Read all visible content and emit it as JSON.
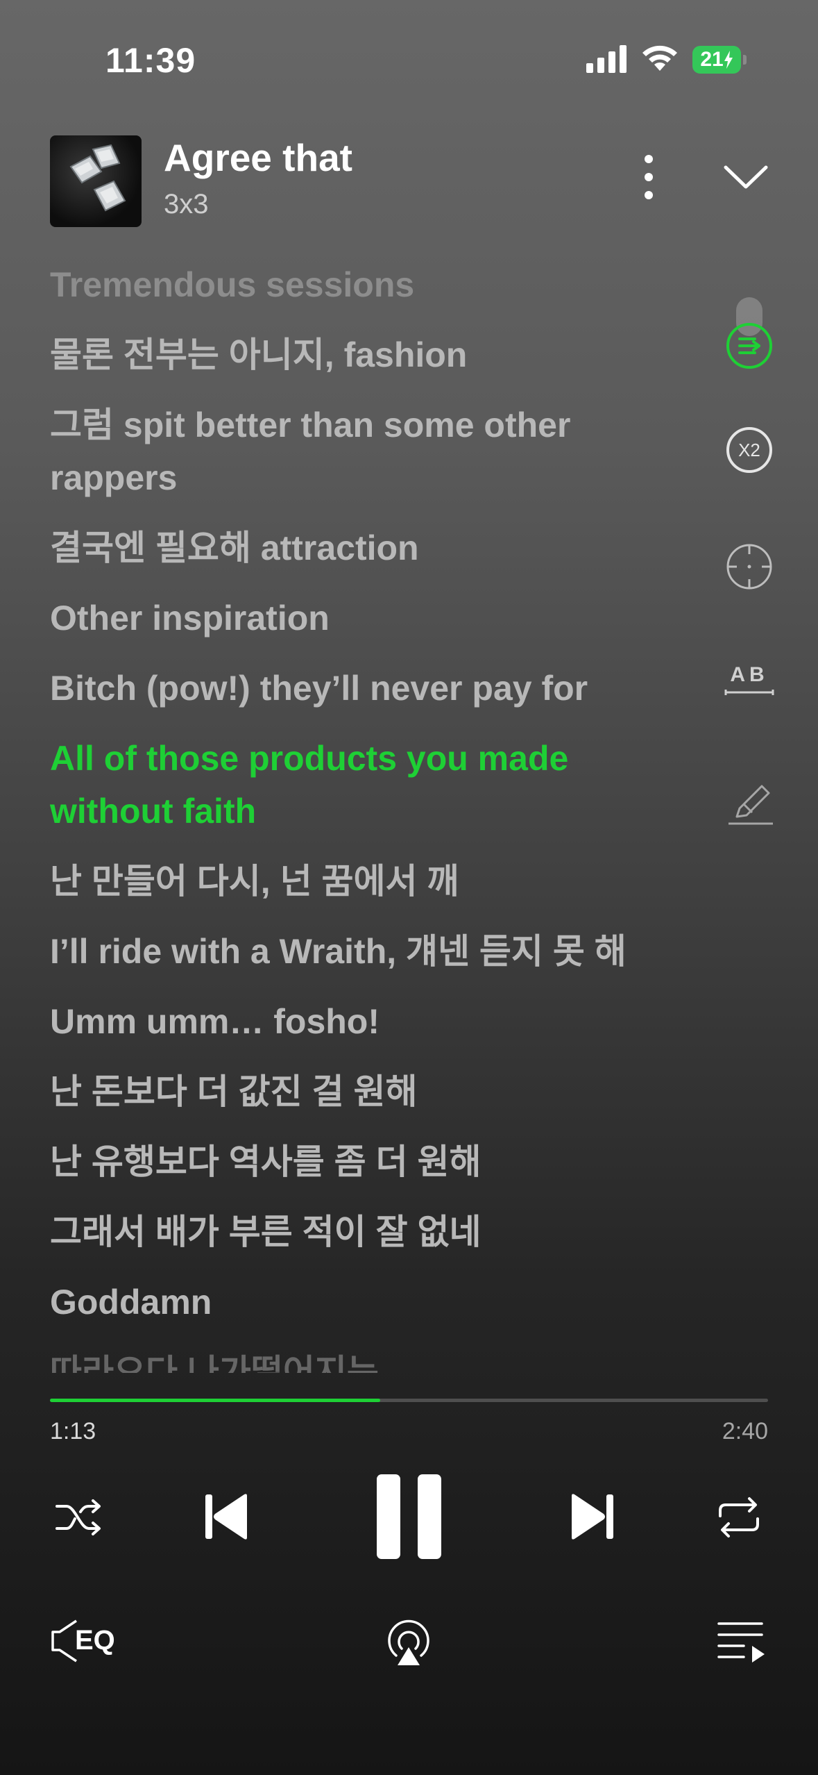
{
  "status_bar": {
    "time": "11:39",
    "battery_level": "21",
    "battery_color": "#34c759",
    "icons": [
      "signal-icon",
      "wifi-icon",
      "battery-charging-icon"
    ]
  },
  "track": {
    "title": "Agree that",
    "artist": "3x3",
    "album_art": "ice-cubes-artwork"
  },
  "header_icons": [
    "more-vertical-icon",
    "chevron-down-icon"
  ],
  "lyrics": [
    {
      "text": "Tremendous sessions",
      "state": "past"
    },
    {
      "text": "물론 전부는 아니지, fashion",
      "state": "normal"
    },
    {
      "text": "그럼 spit better than some other rappers",
      "state": "normal"
    },
    {
      "text": "결국엔 필요해 attraction",
      "state": "normal"
    },
    {
      "text": "Other inspiration",
      "state": "normal"
    },
    {
      "text": "Bitch (pow!) they’ll never pay for",
      "state": "normal"
    },
    {
      "text": "All of those products you made without faith",
      "state": "active"
    },
    {
      "text": "난 만들어 다시, 넌 꿈에서 깨",
      "state": "normal"
    },
    {
      "text": "I’ll ride with a Wraith, 걔넨 듣지 못 해",
      "state": "normal"
    },
    {
      "text": "Umm umm… fosho!",
      "state": "normal"
    },
    {
      "text": "난 돈보다 더 값진 걸 원해",
      "state": "normal"
    },
    {
      "text": "난 유행보다 역사를 좀 더 원해",
      "state": "normal"
    },
    {
      "text": "그래서 배가 부른 적이 잘 없네",
      "state": "normal"
    },
    {
      "text": "Goddamn",
      "state": "normal"
    },
    {
      "text": "따라오다 나가떨어지는",
      "state": "cut"
    }
  ],
  "side_tools": {
    "x2_label": "X2",
    "ab_label": "AB",
    "icons": [
      "auto-scroll-icon",
      "speed-x2-icon",
      "locate-icon",
      "ab-repeat-icon",
      "highlight-pen-icon"
    ],
    "accent": "#1ed035"
  },
  "playback": {
    "elapsed": "1:13",
    "total": "2:40",
    "progress": 0.46,
    "accent": "#1ed035"
  },
  "controls": [
    "shuffle-icon",
    "previous-icon",
    "pause-icon",
    "next-icon",
    "repeat-icon"
  ],
  "bottom_bar": {
    "eq_label": "EQ",
    "icons": [
      "equalizer-icon",
      "airplay-icon",
      "queue-icon"
    ]
  }
}
